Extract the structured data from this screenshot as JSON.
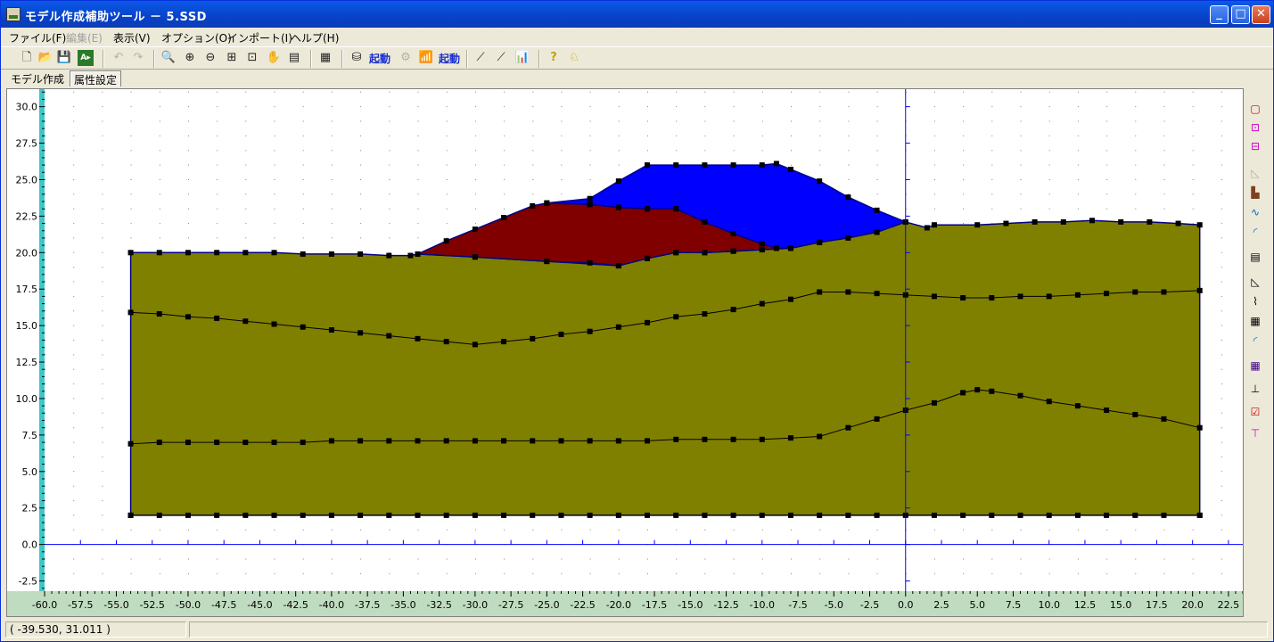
{
  "window": {
    "title": "モデル作成補助ツール － 5.SSD"
  },
  "menu": [
    {
      "label": "ファイル(F)",
      "disabled": false
    },
    {
      "label": "編集(E)",
      "disabled": true
    },
    {
      "label": "表示(V)",
      "disabled": false
    },
    {
      "label": "オプション(O)",
      "disabled": false
    },
    {
      "label": "インポート(I)",
      "disabled": false
    },
    {
      "label": "ヘルプ(H)",
      "disabled": false
    }
  ],
  "toolbar": {
    "launch1": "起動",
    "launch2": "起動"
  },
  "tabs": [
    {
      "label": "モデル作成",
      "active": false
    },
    {
      "label": "属性設定",
      "active": true
    }
  ],
  "status": {
    "coords": "( -39.530,   31.011 )"
  },
  "colors": {
    "layer_lower": "#808000",
    "layer_middle_red": "#800000",
    "layer_top_blue": "#0000ff",
    "outline": "#000080",
    "axis": "#0000ff",
    "ruler_left": "#3cc8c8",
    "ruler_bottom": "#c0dcc0"
  },
  "chart_data": {
    "type": "area",
    "xlim": [
      -60,
      23.5
    ],
    "ylim": [
      -3.2,
      31.2
    ],
    "x_ticks": [
      "-60.0",
      "-57.5",
      "-55.0",
      "-52.5",
      "-50.0",
      "-47.5",
      "-45.0",
      "-42.5",
      "-40.0",
      "-37.5",
      "-35.0",
      "-32.5",
      "-30.0",
      "-27.5",
      "-25.0",
      "-22.5",
      "-20.0",
      "-17.5",
      "-15.0",
      "-12.5",
      "-10.0",
      "-7.5",
      "-5.0",
      "-2.5",
      "0.0",
      "2.5",
      "5.0",
      "7.5",
      "10.0",
      "12.5",
      "15.0",
      "17.5",
      "20.0",
      "22.5"
    ],
    "y_ticks": [
      "30.0",
      "27.5",
      "25.0",
      "22.5",
      "20.0",
      "17.5",
      "15.0",
      "12.5",
      "10.0",
      "7.5",
      "5.0",
      "2.5",
      "0.0",
      "-2.5"
    ],
    "regions": [
      {
        "name": "ground",
        "color": "#808000",
        "points": [
          [
            -54,
            2
          ],
          [
            -54,
            20
          ],
          [
            -52,
            20
          ],
          [
            -50,
            20
          ],
          [
            -48,
            20
          ],
          [
            -46,
            20
          ],
          [
            -44,
            20
          ],
          [
            -42,
            19.9
          ],
          [
            -40,
            19.9
          ],
          [
            -38,
            19.9
          ],
          [
            -36,
            19.8
          ],
          [
            -34.5,
            19.8
          ],
          [
            -34,
            19.9
          ],
          [
            -30,
            19.7
          ],
          [
            -25,
            19.4
          ],
          [
            -20,
            19.1
          ],
          [
            -18,
            19.6
          ],
          [
            -16,
            20.0
          ],
          [
            -14,
            20.0
          ],
          [
            -12,
            20.1
          ],
          [
            -10,
            20.2
          ],
          [
            -8,
            20.3
          ],
          [
            -6,
            20.7
          ],
          [
            -2,
            21.4
          ],
          [
            0,
            22.1
          ],
          [
            1.5,
            21.7
          ],
          [
            2,
            21.9
          ],
          [
            5,
            21.9
          ],
          [
            7,
            22
          ],
          [
            9,
            22.1
          ],
          [
            11,
            22.1
          ],
          [
            13,
            22.2
          ],
          [
            15,
            22.1
          ],
          [
            17,
            22.1
          ],
          [
            19,
            22
          ],
          [
            20.5,
            21.9
          ],
          [
            20.5,
            2
          ]
        ]
      },
      {
        "name": "red-layer",
        "color": "#800000",
        "points": [
          [
            -34,
            19.9
          ],
          [
            -32,
            20.8
          ],
          [
            -30,
            21.6
          ],
          [
            -28,
            22.4
          ],
          [
            -26,
            23.2
          ],
          [
            -25,
            23.4
          ],
          [
            -22,
            23.3
          ],
          [
            -20,
            23.1
          ],
          [
            -18,
            23
          ],
          [
            -16,
            23
          ],
          [
            -14,
            22.1
          ],
          [
            -12,
            21.3
          ],
          [
            -10,
            20.6
          ],
          [
            -9,
            20.3
          ],
          [
            -8,
            20.3
          ],
          [
            -10,
            20.2
          ],
          [
            -12,
            20.1
          ],
          [
            -14,
            20.0
          ],
          [
            -16,
            20.0
          ],
          [
            -18,
            19.6
          ],
          [
            -20,
            19.1
          ],
          [
            -22,
            19.3
          ],
          [
            -25,
            19.4
          ],
          [
            -30,
            19.7
          ]
        ]
      },
      {
        "name": "blue-layer",
        "color": "#0000ff",
        "points": [
          [
            -25,
            23.4
          ],
          [
            -22,
            23.7
          ],
          [
            -20,
            24.9
          ],
          [
            -18,
            26
          ],
          [
            -16,
            26
          ],
          [
            -14,
            26
          ],
          [
            -12,
            26
          ],
          [
            -10,
            26
          ],
          [
            -9,
            26.1
          ],
          [
            -8,
            25.7
          ],
          [
            -6,
            24.9
          ],
          [
            -4,
            23.8
          ],
          [
            -2,
            22.9
          ],
          [
            0,
            22.1
          ],
          [
            -2,
            21.4
          ],
          [
            -4,
            21.0
          ],
          [
            -6,
            20.7
          ],
          [
            -8,
            20.3
          ],
          [
            -9,
            20.3
          ],
          [
            -10,
            20.6
          ],
          [
            -12,
            21.3
          ],
          [
            -14,
            22.1
          ],
          [
            -16,
            23
          ],
          [
            -18,
            23
          ],
          [
            -20,
            23.1
          ],
          [
            -22,
            23.3
          ]
        ]
      }
    ],
    "lines": [
      {
        "name": "boundary-upper-middle",
        "points": [
          [
            -54,
            15.9
          ],
          [
            -52,
            15.8
          ],
          [
            -50,
            15.6
          ],
          [
            -48,
            15.5
          ],
          [
            -46,
            15.3
          ],
          [
            -44,
            15.1
          ],
          [
            -42,
            14.9
          ],
          [
            -40,
            14.7
          ],
          [
            -38,
            14.5
          ],
          [
            -36,
            14.3
          ],
          [
            -34,
            14.1
          ],
          [
            -32,
            13.9
          ],
          [
            -30,
            13.7
          ],
          [
            -28,
            13.9
          ],
          [
            -26,
            14.1
          ],
          [
            -24,
            14.4
          ],
          [
            -22,
            14.6
          ],
          [
            -20,
            14.9
          ],
          [
            -18,
            15.2
          ],
          [
            -16,
            15.6
          ],
          [
            -14,
            15.8
          ],
          [
            -12,
            16.1
          ],
          [
            -10,
            16.5
          ],
          [
            -8,
            16.8
          ],
          [
            -6,
            17.3
          ],
          [
            -4,
            17.3
          ],
          [
            -2,
            17.2
          ],
          [
            0,
            17.1
          ],
          [
            2,
            17
          ],
          [
            4,
            16.9
          ],
          [
            6,
            16.9
          ],
          [
            8,
            17
          ],
          [
            10,
            17
          ],
          [
            12,
            17.1
          ],
          [
            14,
            17.2
          ],
          [
            16,
            17.3
          ],
          [
            18,
            17.3
          ],
          [
            20.5,
            17.4
          ]
        ]
      },
      {
        "name": "boundary-lower-middle",
        "points": [
          [
            -54,
            6.9
          ],
          [
            -52,
            7.0
          ],
          [
            -50,
            7.0
          ],
          [
            -48,
            7.0
          ],
          [
            -46,
            7.0
          ],
          [
            -44,
            7.0
          ],
          [
            -42,
            7.0
          ],
          [
            -40,
            7.1
          ],
          [
            -38,
            7.1
          ],
          [
            -36,
            7.1
          ],
          [
            -34,
            7.1
          ],
          [
            -32,
            7.1
          ],
          [
            -30,
            7.1
          ],
          [
            -28,
            7.1
          ],
          [
            -26,
            7.1
          ],
          [
            -24,
            7.1
          ],
          [
            -22,
            7.1
          ],
          [
            -20,
            7.1
          ],
          [
            -18,
            7.1
          ],
          [
            -16,
            7.2
          ],
          [
            -14,
            7.2
          ],
          [
            -12,
            7.2
          ],
          [
            -10,
            7.2
          ],
          [
            -8,
            7.3
          ],
          [
            -6,
            7.4
          ],
          [
            -4,
            8.0
          ],
          [
            -2,
            8.6
          ],
          [
            0,
            9.2
          ],
          [
            2,
            9.7
          ],
          [
            4,
            10.4
          ],
          [
            5,
            10.6
          ],
          [
            6,
            10.5
          ],
          [
            8,
            10.2
          ],
          [
            10,
            9.8
          ],
          [
            12,
            9.5
          ],
          [
            14,
            9.2
          ],
          [
            16,
            8.9
          ],
          [
            18,
            8.6
          ],
          [
            20.5,
            8.0
          ]
        ]
      },
      {
        "name": "boundary-base",
        "points": [
          [
            -54,
            2
          ],
          [
            -52,
            2
          ],
          [
            -50,
            2
          ],
          [
            -48,
            2
          ],
          [
            -46,
            2
          ],
          [
            -44,
            2
          ],
          [
            -42,
            2
          ],
          [
            -40,
            2
          ],
          [
            -38,
            2
          ],
          [
            -36,
            2
          ],
          [
            -34,
            2
          ],
          [
            -32,
            2
          ],
          [
            -30,
            2
          ],
          [
            -28,
            2
          ],
          [
            -26,
            2
          ],
          [
            -24,
            2
          ],
          [
            -22,
            2
          ],
          [
            -20,
            2
          ],
          [
            -18,
            2
          ],
          [
            -16,
            2
          ],
          [
            -14,
            2
          ],
          [
            -12,
            2
          ],
          [
            -10,
            2
          ],
          [
            -8,
            2
          ],
          [
            -6,
            2
          ],
          [
            -4,
            2
          ],
          [
            -2,
            2
          ],
          [
            0,
            2
          ],
          [
            2,
            2
          ],
          [
            4,
            2
          ],
          [
            6,
            2
          ],
          [
            8,
            2
          ],
          [
            10,
            2
          ],
          [
            12,
            2
          ],
          [
            14,
            2
          ],
          [
            16,
            2
          ],
          [
            18,
            2
          ],
          [
            20.5,
            2
          ]
        ]
      }
    ]
  }
}
